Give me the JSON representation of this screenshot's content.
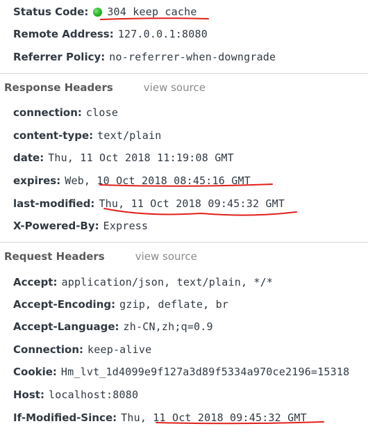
{
  "general": [
    {
      "key": "Status Code:",
      "value": "304 keep cache"
    },
    {
      "key": "Remote Address:",
      "value": "127.0.0.1:8080"
    },
    {
      "key": "Referrer Policy:",
      "value": "no-referrer-when-downgrade"
    }
  ],
  "response": {
    "title": "Response Headers",
    "view_source": "view source",
    "headers": [
      {
        "key": "connection:",
        "value": "close"
      },
      {
        "key": "content-type:",
        "value": "text/plain"
      },
      {
        "key": "date:",
        "value": "Thu, 11 Oct 2018 11:19:08 GMT"
      },
      {
        "key": "expires:",
        "value": "Web, 10 Oct 2018 08:45:16 GMT"
      },
      {
        "key": "last-modified:",
        "value": "Thu, 11 Oct 2018 09:45:32 GMT"
      },
      {
        "key": "X-Powered-By:",
        "value": "Express"
      }
    ]
  },
  "request": {
    "title": "Request Headers",
    "view_source": "view source",
    "headers": [
      {
        "key": "Accept:",
        "value": "application/json, text/plain, */*"
      },
      {
        "key": "Accept-Encoding:",
        "value": "gzip, deflate, br"
      },
      {
        "key": "Accept-Language:",
        "value": "zh-CN,zh;q=0.9"
      },
      {
        "key": "Connection:",
        "value": "keep-alive"
      },
      {
        "key": "Cookie:",
        "value": "Hm_lvt_1d4099e9f127a3d89f5334a970ce2196=15318"
      },
      {
        "key": "Host:",
        "value": "localhost:8080"
      },
      {
        "key": "If-Modified-Since:",
        "value": "Thu, 11 Oct 2018 09:45:32 GMT"
      }
    ]
  },
  "colors": {
    "status_dot": "#22b522",
    "annotation_red": "#e0201b",
    "divider": "#d6d6d6"
  }
}
